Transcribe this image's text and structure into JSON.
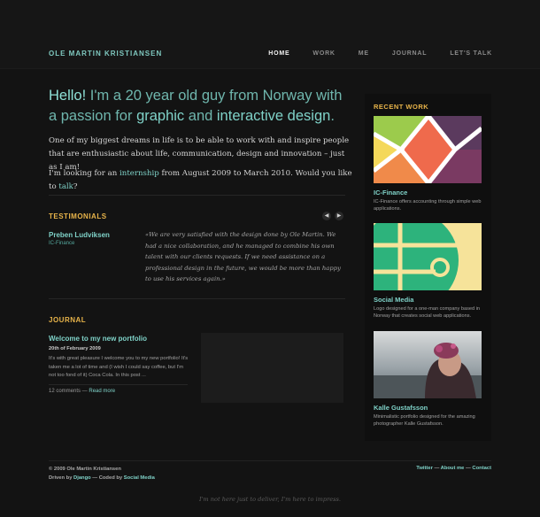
{
  "header": {
    "brand": "OLE MARTIN KRISTIANSEN",
    "nav": [
      {
        "label": "HOME",
        "active": true
      },
      {
        "label": "WORK"
      },
      {
        "label": "ME"
      },
      {
        "label": "JOURNAL"
      },
      {
        "label": "LET'S TALK"
      }
    ]
  },
  "intro": {
    "hello": "Hello!",
    "h1": " I'm a 20 year old guy from Norway with a passion for ",
    "h_graphic": "graphic",
    "h_and": " and ",
    "h_interactive": "interactive design",
    "h_end": ".",
    "p1": "One of my biggest dreams in life is to be able to work with and inspire people that are enthusiastic about life, communication, design and innovation – just as I am!",
    "p2_a": "I'm looking for an ",
    "p2_link": "internship",
    "p2_b": " from August 2009 to March 2010. Would you like to ",
    "p2_talk": "talk",
    "p2_end": "?"
  },
  "testimonials": {
    "title": "TESTIMONIALS",
    "prev": "◀",
    "next": "▶",
    "name": "Preben Ludviksen",
    "company": "IC-Finance",
    "quote": "«We are very satisfied with the design done by Ole Martin. We had a nice collaboration, and he managed to combine his own talent with our clients requests. If we need assistance on a professional design in the future, we would be more than happy to use his services again.»"
  },
  "journal": {
    "title": "JOURNAL",
    "post_title": "Welcome to my new portfolio",
    "date": "20th of February 2009",
    "excerpt": "It's with great pleasure I welcome you to my new portfolio! It's taken me a lot of time and (I wish I could say coffee, but I'm not too fond of it) Coca Cola. In this post ...",
    "comments": "12 comments",
    "sep": " — ",
    "read_more": "Read more"
  },
  "recent_work": {
    "title": "RECENT WORK",
    "items": [
      {
        "name": "IC-Finance",
        "desc": "IC-Finance offers accounting through simple web applications."
      },
      {
        "name": "Social Media",
        "desc": "Logo designed for a one-man company based in Norway that creates social web applications."
      },
      {
        "name": "Kalle Gustafsson",
        "desc": "Minimalistic portfolio designed for the amazing photographer Kalle Gustafsson."
      }
    ]
  },
  "footer": {
    "copyright": "© 2009 Ole Martin Kristiansen",
    "driven_a": "Driven by ",
    "driven_link": "Django",
    "coded_a": " — Coded by ",
    "coded_link": "Social Media",
    "links": [
      "Twitter",
      "About me",
      "Contact"
    ],
    "link_sep": " — ",
    "tagline": "I'm not here just to deliver, I'm here to impress."
  },
  "colors": {
    "accent": "#7fd2c8",
    "section_title": "#e8b44a",
    "background": "#131313"
  }
}
